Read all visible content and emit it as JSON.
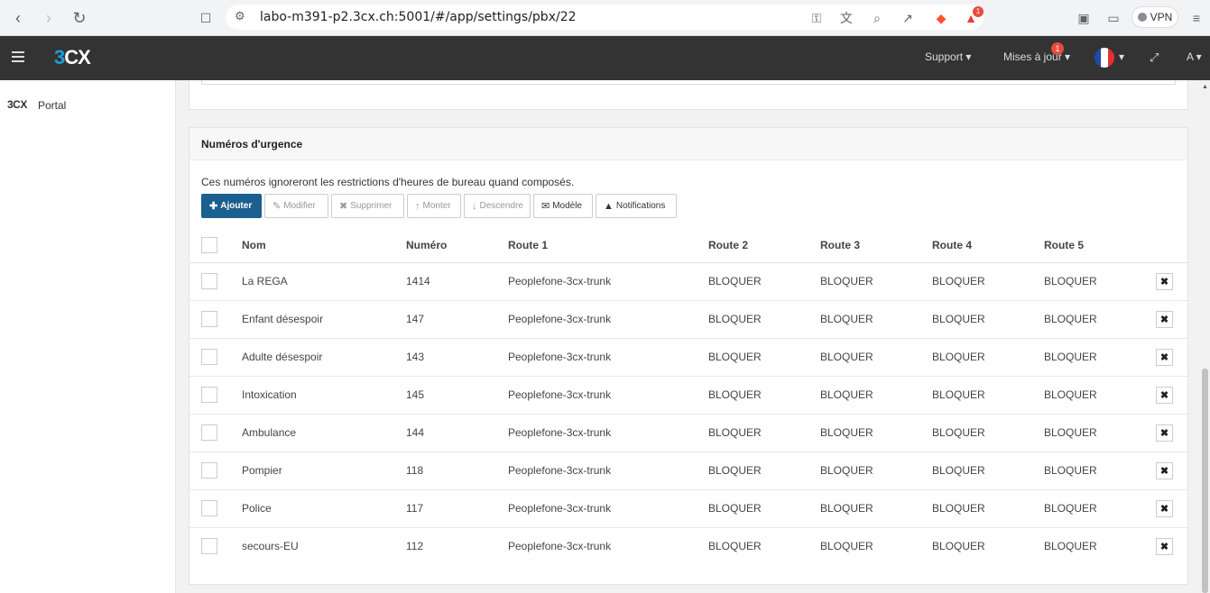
{
  "browser": {
    "url": "labo-m391-p2.3cx.ch:5001/#/app/settings/pbx/22",
    "vpn_label": "VPN",
    "extension_badge": "1"
  },
  "header": {
    "logo_prefix": "3",
    "logo_suffix": "CX",
    "support": "Support",
    "updates": "Mises à jour",
    "updates_badge": "1",
    "user": "A"
  },
  "sidebar": {
    "logo": "3CX",
    "portal": "Portal"
  },
  "panel": {
    "title": "Numéros d'urgence",
    "description": "Ces numéros ignoreront les restrictions d'heures de bureau quand composés.",
    "toolbar": {
      "add": "Ajouter",
      "edit": "Modifier",
      "delete": "Supprimer",
      "up": "Monter",
      "down": "Descendre",
      "template": "Modèle",
      "notifications": "Notifications"
    },
    "columns": [
      "Nom",
      "Numéro",
      "Route 1",
      "Route 2",
      "Route 3",
      "Route 4",
      "Route 5"
    ],
    "rows": [
      {
        "name": "La REGA",
        "number": "1414",
        "r1": "Peoplefone-3cx-trunk",
        "r2": "BLOQUER",
        "r3": "BLOQUER",
        "r4": "BLOQUER",
        "r5": "BLOQUER"
      },
      {
        "name": "Enfant désespoir",
        "number": "147",
        "r1": "Peoplefone-3cx-trunk",
        "r2": "BLOQUER",
        "r3": "BLOQUER",
        "r4": "BLOQUER",
        "r5": "BLOQUER"
      },
      {
        "name": "Adulte désespoir",
        "number": "143",
        "r1": "Peoplefone-3cx-trunk",
        "r2": "BLOQUER",
        "r3": "BLOQUER",
        "r4": "BLOQUER",
        "r5": "BLOQUER"
      },
      {
        "name": "Intoxication",
        "number": "145",
        "r1": "Peoplefone-3cx-trunk",
        "r2": "BLOQUER",
        "r3": "BLOQUER",
        "r4": "BLOQUER",
        "r5": "BLOQUER"
      },
      {
        "name": "Ambulance",
        "number": "144",
        "r1": "Peoplefone-3cx-trunk",
        "r2": "BLOQUER",
        "r3": "BLOQUER",
        "r4": "BLOQUER",
        "r5": "BLOQUER"
      },
      {
        "name": "Pompier",
        "number": "118",
        "r1": "Peoplefone-3cx-trunk",
        "r2": "BLOQUER",
        "r3": "BLOQUER",
        "r4": "BLOQUER",
        "r5": "BLOQUER"
      },
      {
        "name": "Police",
        "number": "117",
        "r1": "Peoplefone-3cx-trunk",
        "r2": "BLOQUER",
        "r3": "BLOQUER",
        "r4": "BLOQUER",
        "r5": "BLOQUER"
      },
      {
        "name": "secours-EU",
        "number": "112",
        "r1": "Peoplefone-3cx-trunk",
        "r2": "BLOQUER",
        "r3": "BLOQUER",
        "r4": "BLOQUER",
        "r5": "BLOQUER"
      }
    ]
  }
}
